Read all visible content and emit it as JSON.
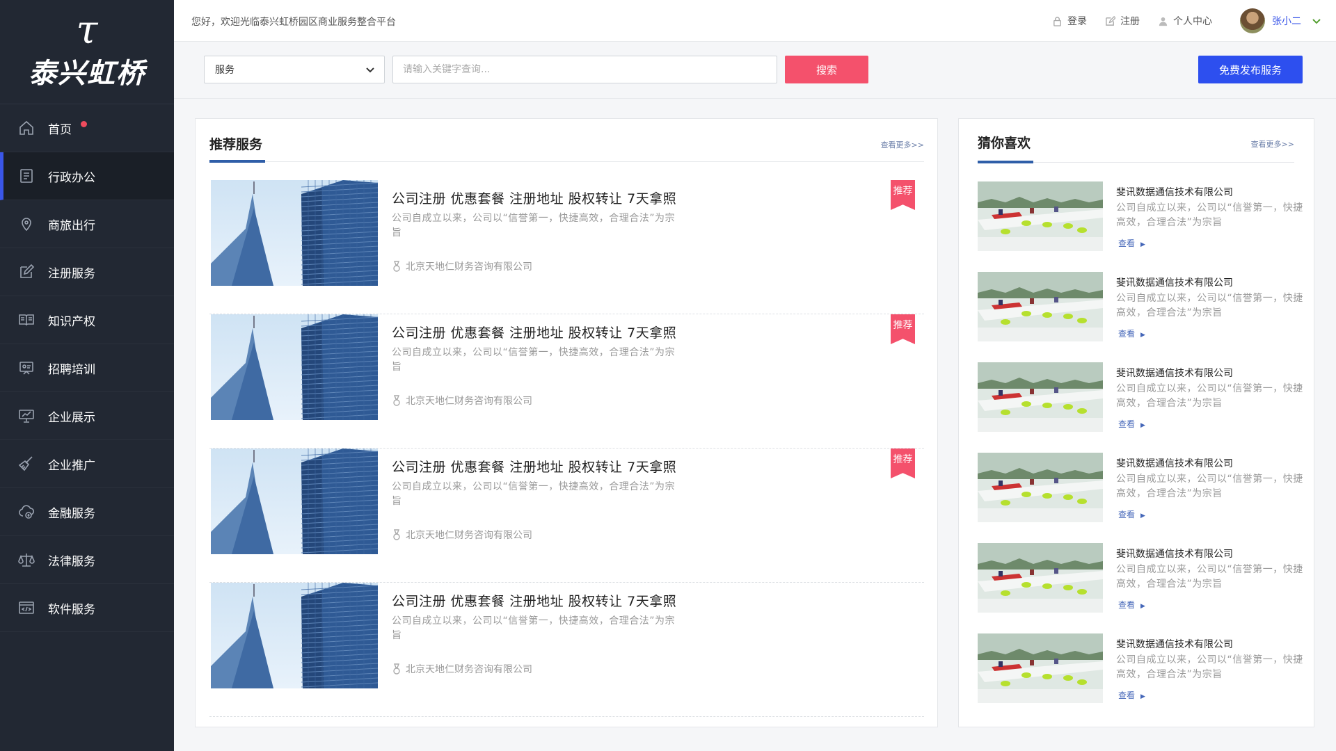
{
  "brand": {
    "mark": "τ",
    "name": "泰兴虹桥"
  },
  "sidebar": {
    "items": [
      {
        "label": "首页",
        "icon": "home-icon"
      },
      {
        "label": "行政办公",
        "icon": "document-icon"
      },
      {
        "label": "商旅出行",
        "icon": "location-icon"
      },
      {
        "label": "注册服务",
        "icon": "edit-icon"
      },
      {
        "label": "知识产权",
        "icon": "book-icon"
      },
      {
        "label": "招聘培训",
        "icon": "presentation-icon"
      },
      {
        "label": "企业展示",
        "icon": "chart-board-icon"
      },
      {
        "label": "企业推广",
        "icon": "broom-icon"
      },
      {
        "label": "金融服务",
        "icon": "cloud-money-icon"
      },
      {
        "label": "法律服务",
        "icon": "scales-icon"
      },
      {
        "label": "软件服务",
        "icon": "code-window-icon"
      }
    ],
    "active_index": 1,
    "notify_index": 0
  },
  "topbar": {
    "welcome": "您好，欢迎光临泰兴虹桥园区商业服务整合平台",
    "login": "登录",
    "register": "注册",
    "profile": "个人中心",
    "username": "张小二"
  },
  "search": {
    "category": "服务",
    "placeholder": "请输入关键字查询...",
    "button": "搜索",
    "publish": "免费发布服务"
  },
  "recommend": {
    "title": "推荐服务",
    "more": "查看更多>>",
    "badge": "推荐",
    "items": [
      {
        "title": "公司注册 优惠套餐 注册地址 股权转让 7天拿照",
        "desc": "公司自成立以来，公司以“信誉第一，快捷高效，合理合法”为宗旨",
        "company": "北京天地仁财务咨询有限公司",
        "recommended": true
      },
      {
        "title": "公司注册 优惠套餐 注册地址 股权转让 7天拿照",
        "desc": "公司自成立以来，公司以“信誉第一，快捷高效，合理合法”为宗旨",
        "company": "北京天地仁财务咨询有限公司",
        "recommended": true
      },
      {
        "title": "公司注册 优惠套餐 注册地址 股权转让 7天拿照",
        "desc": "公司自成立以来，公司以“信誉第一，快捷高效，合理合法”为宗旨",
        "company": "北京天地仁财务咨询有限公司",
        "recommended": true
      },
      {
        "title": "公司注册 优惠套餐 注册地址 股权转让 7天拿照",
        "desc": "公司自成立以来，公司以“信誉第一，快捷高效，合理合法”为宗旨",
        "company": "北京天地仁财务咨询有限公司",
        "recommended": false
      }
    ]
  },
  "guess": {
    "title": "猜你喜欢",
    "more": "查看更多>>",
    "view": "查看",
    "items": [
      {
        "title": "斐讯数据通信技术有限公司",
        "desc": "公司自成立以来，公司以“信誉第一，快捷高效，合理合法”为宗旨"
      },
      {
        "title": "斐讯数据通信技术有限公司",
        "desc": "公司自成立以来，公司以“信誉第一，快捷高效，合理合法”为宗旨"
      },
      {
        "title": "斐讯数据通信技术有限公司",
        "desc": "公司自成立以来，公司以“信誉第一，快捷高效，合理合法”为宗旨"
      },
      {
        "title": "斐讯数据通信技术有限公司",
        "desc": "公司自成立以来，公司以“信誉第一，快捷高效，合理合法”为宗旨"
      },
      {
        "title": "斐讯数据通信技术有限公司",
        "desc": "公司自成立以来，公司以“信誉第一，快捷高效，合理合法”为宗旨"
      },
      {
        "title": "斐讯数据通信技术有限公司",
        "desc": "公司自成立以来，公司以“信誉第一，快捷高效，合理合法”为宗旨"
      }
    ]
  },
  "colors": {
    "sidebar_bg": "#222833",
    "accent_blue": "#2d4fef",
    "accent_red": "#f4516c"
  }
}
